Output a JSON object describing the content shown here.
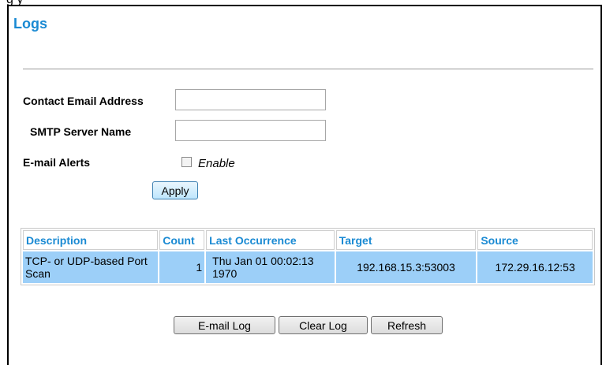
{
  "top_caption": "g                  y",
  "page": {
    "title": "Logs"
  },
  "form": {
    "email_label": "Contact Email Address",
    "email_value": "",
    "smtp_label": "SMTP Server Name",
    "smtp_value": "",
    "alerts_label": "E-mail Alerts",
    "enable_label": "Enable",
    "enable_checked": false,
    "apply_label": "Apply"
  },
  "table": {
    "headers": [
      "Description",
      "Count",
      "Last Occurrence",
      "Target",
      "Source"
    ],
    "rows": [
      {
        "description": "TCP- or UDP-based Port Scan",
        "count": "1",
        "last_occurrence": "Thu Jan 01 00:02:13 1970",
        "target": "192.168.15.3:53003",
        "source": "172.29.16.12:53"
      }
    ]
  },
  "actions": {
    "email_log": "E-mail Log",
    "clear_log": "Clear Log",
    "refresh": "Refresh"
  },
  "colors": {
    "title": "#1a8ad3",
    "row_bg": "#9ccff8",
    "header_text": "#1a8ad3"
  }
}
